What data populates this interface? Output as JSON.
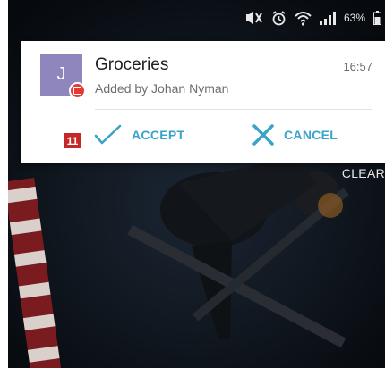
{
  "status_bar": {
    "battery_percent": "63%",
    "icons": [
      "mute-icon",
      "alarm-icon",
      "wifi-icon",
      "signal-icon",
      "battery-icon"
    ]
  },
  "notification": {
    "avatar_letter": "J",
    "avatar_color": "#8e86bd",
    "app_badge_color": "#e53935",
    "title": "Groceries",
    "subtitle": "Added by Johan Nyman",
    "time": "16:57",
    "actions": [
      {
        "label": "ACCEPT",
        "icon": "checkmark-icon"
      },
      {
        "label": "CANCEL",
        "icon": "close-icon"
      }
    ],
    "accent_color": "#3aa3c8"
  },
  "step_badge": "11",
  "clear_label": "CLEAR"
}
